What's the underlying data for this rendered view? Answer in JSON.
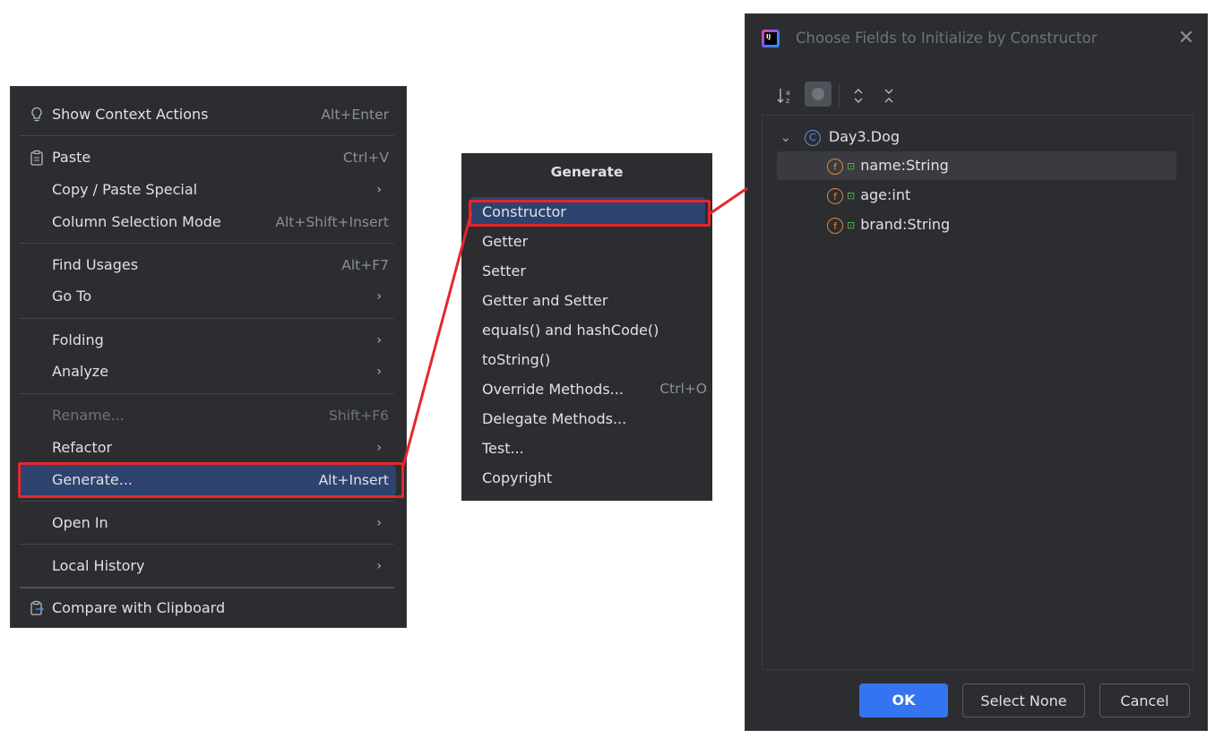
{
  "context_menu": {
    "items": [
      {
        "label": "Show Context Actions",
        "shortcut": "Alt+Enter",
        "icon": "lightbulb-icon"
      },
      {
        "label": "Paste",
        "shortcut": "Ctrl+V",
        "icon": "clipboard-icon"
      },
      {
        "label": "Copy / Paste Special",
        "submenu": true
      },
      {
        "label": "Column Selection Mode",
        "shortcut": "Alt+Shift+Insert"
      },
      {
        "label": "Find Usages",
        "shortcut": "Alt+F7"
      },
      {
        "label": "Go To",
        "submenu": true
      },
      {
        "label": "Folding",
        "submenu": true
      },
      {
        "label": "Analyze",
        "submenu": true
      },
      {
        "label": "Rename...",
        "shortcut": "Shift+F6",
        "disabled": true
      },
      {
        "label": "Refactor",
        "submenu": true
      },
      {
        "label": "Generate...",
        "shortcut": "Alt+Insert",
        "selected": true
      },
      {
        "label": "Open In",
        "submenu": true
      },
      {
        "label": "Local History",
        "submenu": true
      },
      {
        "label": "Compare with Clipboard",
        "icon": "compare-clipboard-icon"
      }
    ],
    "arrow": "›"
  },
  "generate_popup": {
    "title": "Generate",
    "items": [
      {
        "label": "Constructor",
        "selected": true
      },
      {
        "label": "Getter"
      },
      {
        "label": "Setter"
      },
      {
        "label": "Getter and Setter"
      },
      {
        "label": "equals() and hashCode()"
      },
      {
        "label": "toString()"
      },
      {
        "label": "Override Methods...",
        "shortcut": "Ctrl+O"
      },
      {
        "label": "Delegate Methods..."
      },
      {
        "label": "Test..."
      },
      {
        "label": "Copyright"
      }
    ]
  },
  "dialog": {
    "title": "Choose Fields to Initialize by Constructor",
    "logo_text": "IJ",
    "close": "✕",
    "toolbar": {
      "sort": "↓ᵃz",
      "expand": "⌃⌄",
      "collapse": "✕"
    },
    "tree": {
      "class_icon": "C",
      "class_name": "Day3.Dog",
      "chevron": "⌄",
      "field_icon": "f",
      "lock": "🔓",
      "fields": [
        "name:String",
        "age:int",
        "brand:String"
      ]
    },
    "buttons": {
      "ok": "OK",
      "select_none": "Select None",
      "cancel": "Cancel"
    }
  },
  "colors": {
    "accent": "#3574f0",
    "highlight": "#2e436e",
    "annotation": "#e5272b"
  }
}
